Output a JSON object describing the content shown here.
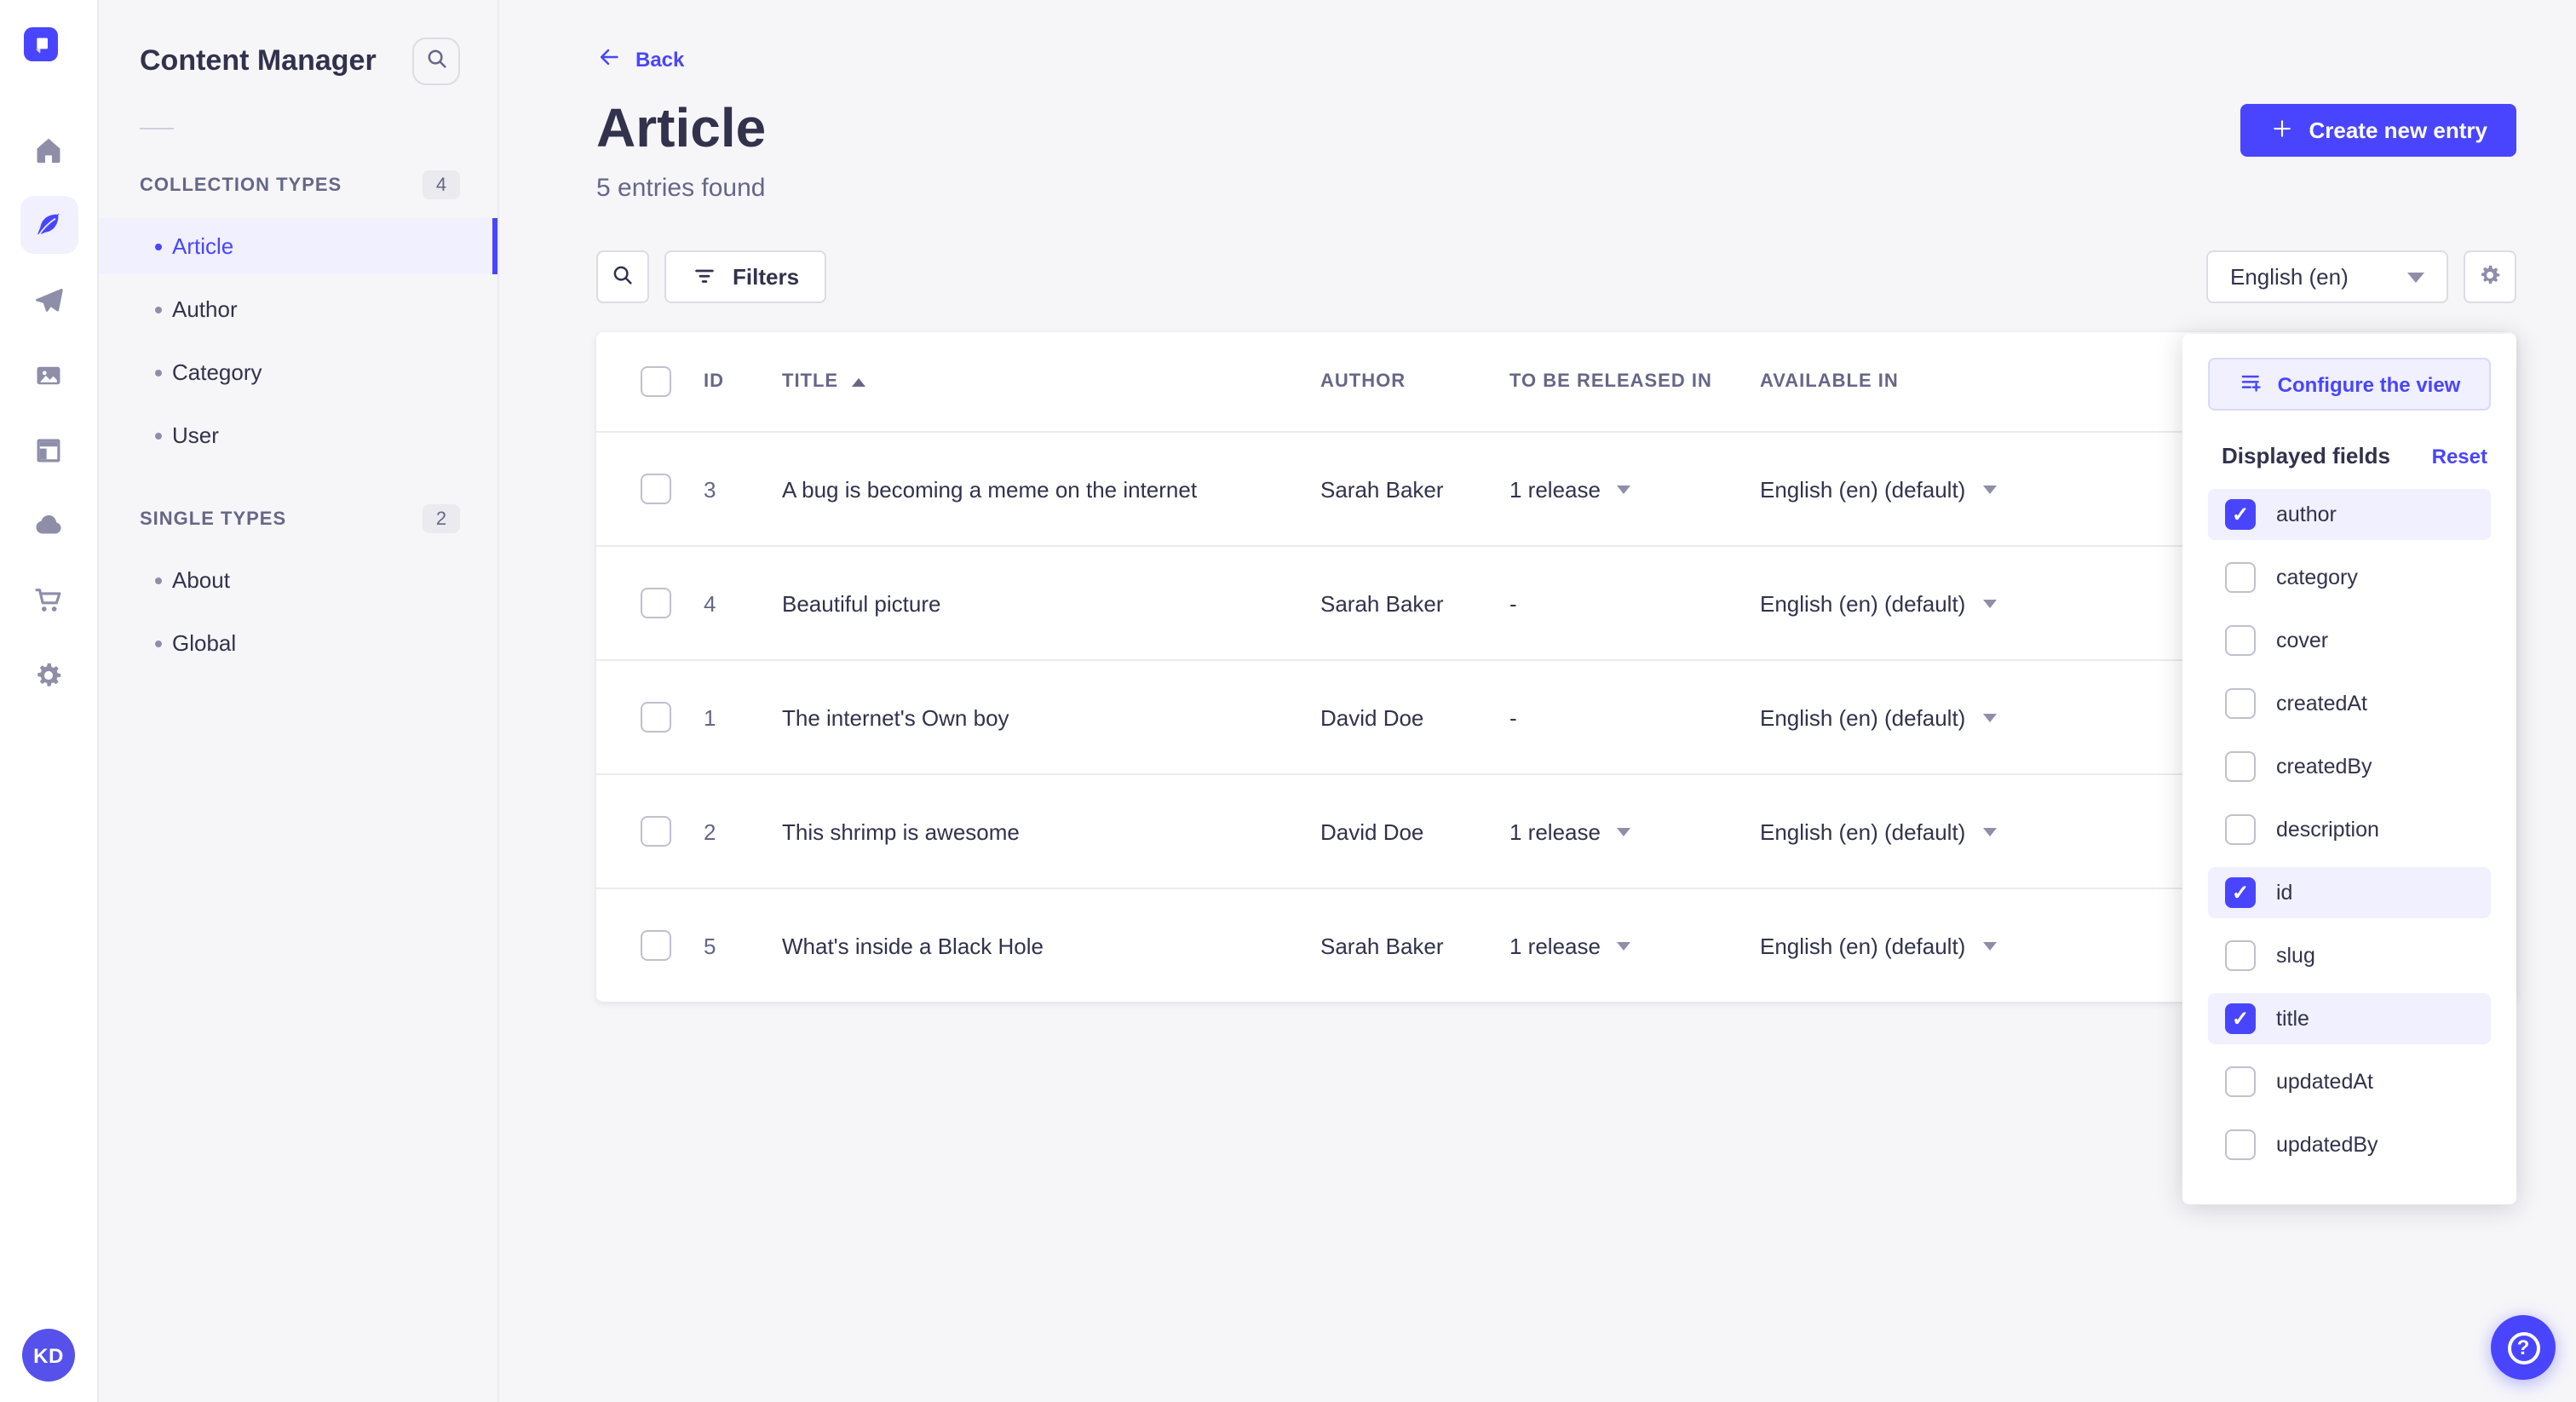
{
  "colors": {
    "accent": "#4945ff",
    "accent_light_bg": "#f0f0ff",
    "accent_border": "#d9d8ff",
    "page_bg": "#f6f6f9",
    "text_dark": "#32324d",
    "text_muted": "#666687",
    "icon_gray": "#8e8ea9",
    "border_neutral": "#eaeaef"
  },
  "rail": {
    "logo": "strapi-logo",
    "icons": [
      {
        "name": "home-icon",
        "active": false
      },
      {
        "name": "content-manager-icon",
        "active": true
      },
      {
        "name": "releases-icon",
        "active": false
      },
      {
        "name": "media-library-icon",
        "active": false
      },
      {
        "name": "content-type-builder-icon",
        "active": false
      },
      {
        "name": "cloud-icon",
        "active": false
      },
      {
        "name": "marketplace-icon",
        "active": false
      },
      {
        "name": "settings-icon",
        "active": false
      }
    ],
    "avatar_initials": "KD"
  },
  "sidebar": {
    "title": "Content Manager",
    "sections": [
      {
        "label": "COLLECTION TYPES",
        "count": "4",
        "items": [
          {
            "label": "Article",
            "active": true
          },
          {
            "label": "Author",
            "active": false
          },
          {
            "label": "Category",
            "active": false
          },
          {
            "label": "User",
            "active": false
          }
        ]
      },
      {
        "label": "SINGLE TYPES",
        "count": "2",
        "items": [
          {
            "label": "About",
            "active": false
          },
          {
            "label": "Global",
            "active": false
          }
        ]
      }
    ]
  },
  "header": {
    "back_label": "Back",
    "title": "Article",
    "subtitle": "5 entries found",
    "create_label": "Create new entry"
  },
  "toolbar": {
    "filters_label": "Filters",
    "locale_value": "English (en)"
  },
  "table": {
    "columns": [
      "ID",
      "TITLE",
      "AUTHOR",
      "TO BE RELEASED IN",
      "AVAILABLE IN"
    ],
    "sorted_by": "TITLE",
    "sort_direction": "asc",
    "rows": [
      {
        "id": "3",
        "title": "A bug is becoming a meme on the internet",
        "author": "Sarah Baker",
        "to_be_released_in": "1 release",
        "release_dropdown": true,
        "available_in": "English (en) (default)"
      },
      {
        "id": "4",
        "title": "Beautiful picture",
        "author": "Sarah Baker",
        "to_be_released_in": "-",
        "release_dropdown": false,
        "available_in": "English (en) (default)"
      },
      {
        "id": "1",
        "title": "The internet's Own boy",
        "author": "David Doe",
        "to_be_released_in": "-",
        "release_dropdown": false,
        "available_in": "English (en) (default)"
      },
      {
        "id": "2",
        "title": "This shrimp is awesome",
        "author": "David Doe",
        "to_be_released_in": "1 release",
        "release_dropdown": true,
        "available_in": "English (en) (default)"
      },
      {
        "id": "5",
        "title": "What's inside a Black Hole",
        "author": "Sarah Baker",
        "to_be_released_in": "1 release",
        "release_dropdown": true,
        "available_in": "English (en) (default)"
      }
    ]
  },
  "popover": {
    "configure_label": "Configure the view",
    "fields_title": "Displayed fields",
    "reset_label": "Reset",
    "fields": [
      {
        "label": "author",
        "checked": true
      },
      {
        "label": "category",
        "checked": false
      },
      {
        "label": "cover",
        "checked": false
      },
      {
        "label": "createdAt",
        "checked": false
      },
      {
        "label": "createdBy",
        "checked": false
      },
      {
        "label": "description",
        "checked": false
      },
      {
        "label": "id",
        "checked": true
      },
      {
        "label": "slug",
        "checked": false
      },
      {
        "label": "title",
        "checked": true
      },
      {
        "label": "updatedAt",
        "checked": false
      },
      {
        "label": "updatedBy",
        "checked": false
      }
    ]
  }
}
